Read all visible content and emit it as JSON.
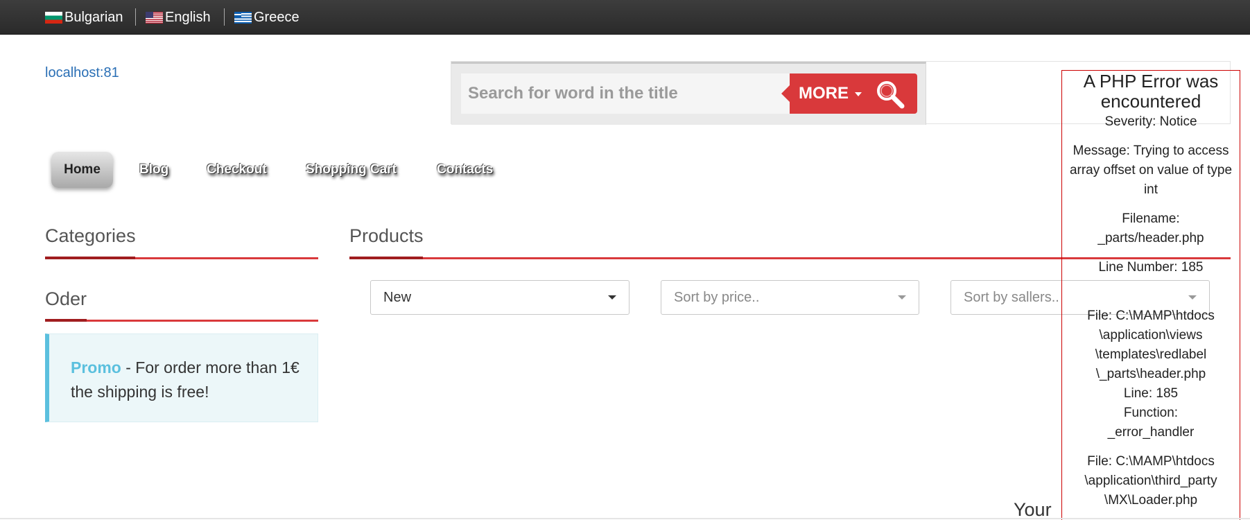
{
  "languages": [
    {
      "label": "Bulgarian",
      "icon": "bulgaria-flag-icon"
    },
    {
      "label": "English",
      "icon": "usa-flag-icon"
    },
    {
      "label": "Greece",
      "icon": "greece-flag-icon"
    }
  ],
  "site": {
    "link": "localhost:81"
  },
  "search": {
    "placeholder": "Search for word in the title",
    "more_label": "MORE",
    "icon": "search-icon",
    "accent": "#d9393b"
  },
  "nav": {
    "items": [
      {
        "label": "Home",
        "active": true
      },
      {
        "label": "Blog"
      },
      {
        "label": "Checkout"
      },
      {
        "label": "Shopping Cart"
      },
      {
        "label": "Contacts"
      }
    ]
  },
  "sidebar": {
    "categories_title": "Categories",
    "order_title": "Oder",
    "promo": {
      "strong": "Promo",
      "text": " - For order more than 1€ the shipping is free!"
    }
  },
  "products": {
    "title": "Products",
    "filters": [
      {
        "value": "New",
        "is_placeholder": false
      },
      {
        "value": "Sort by price..",
        "is_placeholder": true
      },
      {
        "value": "Sort by sallers..",
        "is_placeholder": true
      }
    ]
  },
  "error": {
    "title": "A PHP Error was encountered",
    "severity": "Severity: Notice",
    "message": "Message: Trying to access array offset on value of type int",
    "filename_label": "Filename:",
    "filename": "_parts/header.php",
    "line_number": "Line Number: 185",
    "trace1": {
      "lines": [
        "File: C:\\MAMP\\htdocs",
        "\\application\\views",
        "\\templates\\redlabel",
        "\\_parts\\header.php"
      ],
      "line": "Line: 185",
      "function_label": "Function:",
      "function": "_error_handler"
    },
    "trace2": {
      "lines": [
        "File: C:\\MAMP\\htdocs",
        "\\application\\third_party",
        "\\MX\\Loader.php"
      ]
    }
  },
  "footer_partial": "Your",
  "colors": {
    "brand_red": "#d9393b",
    "dark_red": "#a01d1f",
    "link_blue": "#2a6fb5",
    "promo_blue": "#5bc0de"
  }
}
